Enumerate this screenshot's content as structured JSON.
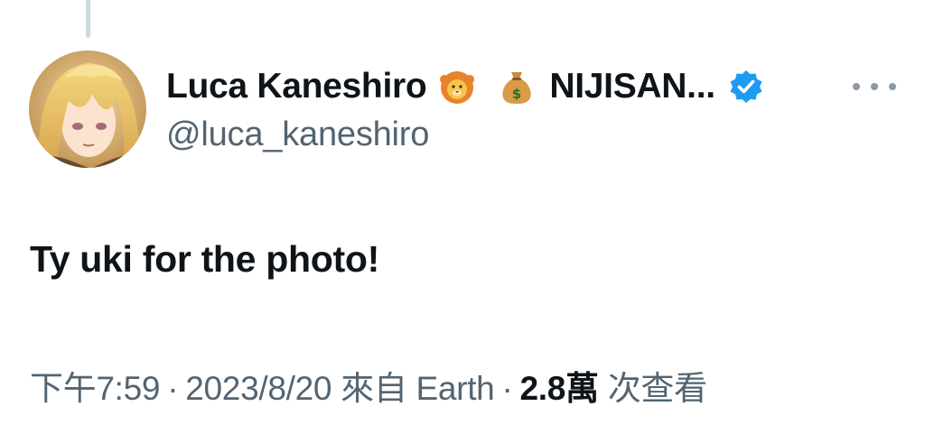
{
  "tweet": {
    "author": {
      "display_name": "Luca Kaneshiro",
      "emoji_1": "lion-emoji",
      "emoji_2": "money-bag-emoji",
      "name_suffix": "NIJISAN...",
      "handle": "@luca_kaneshiro",
      "verified": true,
      "avatar": "avatar-image"
    },
    "more_icon": "more-horizontal-icon",
    "text": "Ty uki for the photo!",
    "meta": {
      "time": "下午7:59",
      "separator": "·",
      "date": "2023/8/20",
      "source": "來自 Earth",
      "views_count": "2.8萬",
      "views_label": "次查看"
    }
  },
  "colors": {
    "text_primary": "#0f1419",
    "text_secondary": "#536471",
    "verified_blue": "#1d9bf0",
    "thread_line": "#cfd9de"
  }
}
